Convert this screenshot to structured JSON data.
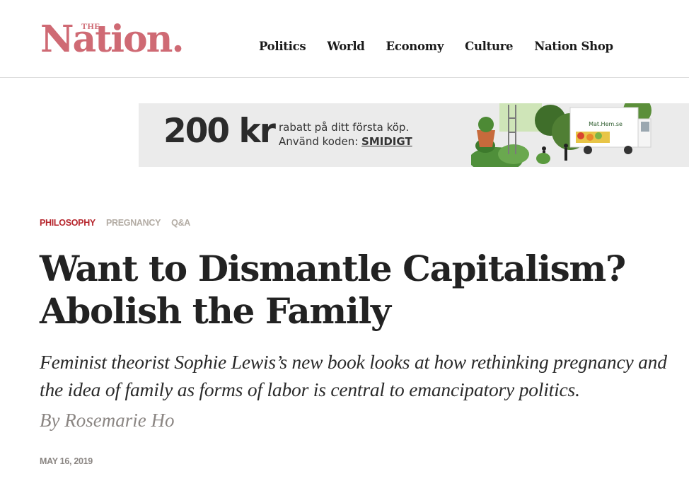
{
  "brand": {
    "the": "THE",
    "name": "Nation."
  },
  "nav": {
    "items": [
      "Politics",
      "World",
      "Economy",
      "Culture",
      "Nation Shop"
    ]
  },
  "ad": {
    "amount": "200 kr",
    "line1": "rabatt på ditt första köp.",
    "line2_prefix": "Använd koden: ",
    "code": "SMIDIGT",
    "truck_label": "Mat.Hem.se"
  },
  "article": {
    "tags": [
      "PHILOSOPHY",
      "PREGNANCY",
      "Q&A"
    ],
    "headline": "Want to Dismantle Capitalism? Abolish the Family",
    "dek": "Feminist theorist Sophie Lewis’s new book looks at how rethinking pregnancy and the idea of family as forms of labor is central to emancipatory politics.",
    "byline_prefix": "By ",
    "author": "Rosemarie Ho",
    "date": "MAY 16, 2019"
  },
  "colors": {
    "brand": "#cf6a74",
    "tag_primary": "#b6262d",
    "tag_secondary": "#b3aca4",
    "ad_background": "#ebebeb"
  }
}
